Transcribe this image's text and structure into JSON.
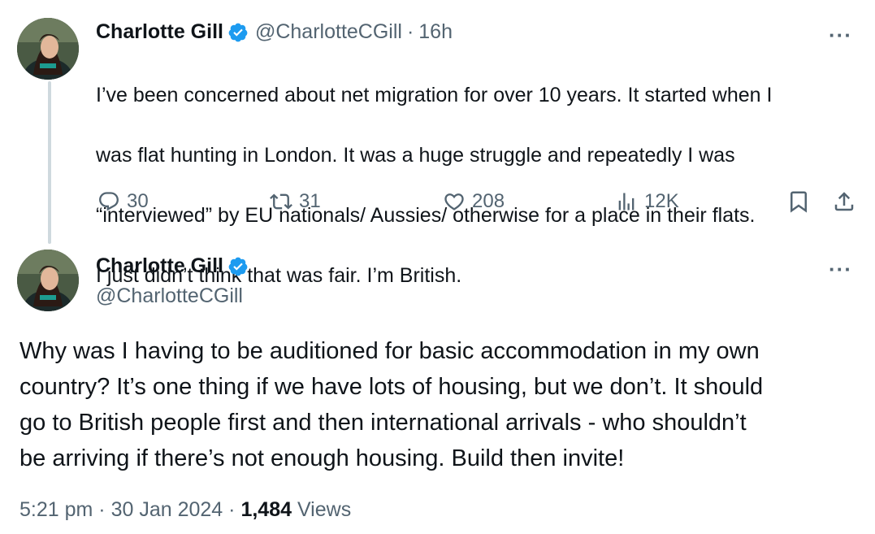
{
  "tweet1": {
    "author_name": "Charlotte Gill",
    "author_handle": "@CharlotteCGill",
    "separator": "·",
    "time_ago": "16h",
    "more_label": "···",
    "text_lines": [
      "I’ve been concerned about net migration for over 10 years. It started when I",
      "was flat hunting in London. It was a huge struggle and repeatedly I was",
      "“interviewed” by EU nationals/ Aussies/ otherwise for a place in their flats.",
      "I just didn’t think that was fair. I’m British."
    ],
    "actions": {
      "replies": "30",
      "retweets": "31",
      "likes": "208",
      "views": "12K"
    }
  },
  "tweet2": {
    "author_name": "Charlotte Gill",
    "author_handle": "@CharlotteCGill",
    "more_label": "···",
    "text_lines": [
      "Why was I having to be auditioned for basic accommodation in my own",
      "country? It’s one thing if we have lots of housing, but we don’t. It should",
      "go to British people first and then international arrivals - who shouldn’t",
      "be arriving if there’s not enough housing. Build then invite!"
    ],
    "timestamp": "5:21 pm",
    "dot": "·",
    "date": "30 Jan 2024",
    "views_count": "1,484",
    "views_label": "Views"
  },
  "colors": {
    "text_primary": "#0f1419",
    "text_secondary": "#536471",
    "verified_blue": "#1d9bf0",
    "thread_line": "#cfd9de"
  },
  "icons": [
    "reply-icon",
    "retweet-icon",
    "like-icon",
    "views-icon",
    "bookmark-icon",
    "share-icon",
    "verified-badge-icon",
    "more-icon"
  ]
}
